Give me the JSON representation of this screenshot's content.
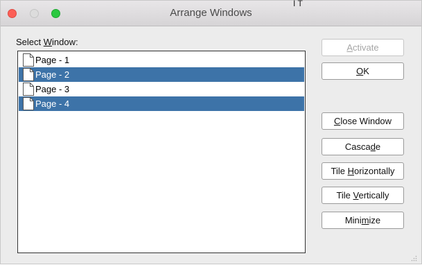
{
  "window": {
    "title": "Arrange Windows",
    "title_fragment": "I T"
  },
  "select_label": {
    "pre": "Select ",
    "mnemonic": "W",
    "post": "indow:"
  },
  "list_items": [
    {
      "label": "Page - 1",
      "selected": false
    },
    {
      "label": "Page - 2",
      "selected": true
    },
    {
      "label": "Page - 3",
      "selected": false
    },
    {
      "label": "Page - 4",
      "selected": true
    }
  ],
  "buttons": {
    "activate": {
      "pre": "",
      "mnemonic": "A",
      "post": "ctivate",
      "enabled": false
    },
    "ok": {
      "pre": "",
      "mnemonic": "O",
      "post": "K",
      "enabled": true
    },
    "close_window": {
      "pre": "",
      "mnemonic": "C",
      "post": "lose Window",
      "enabled": true
    },
    "cascade": {
      "pre": "Casca",
      "mnemonic": "d",
      "post": "e",
      "enabled": true
    },
    "tile_horizontally": {
      "pre": "Tile ",
      "mnemonic": "H",
      "post": "orizontally",
      "enabled": true
    },
    "tile_vertically": {
      "pre": "Tile ",
      "mnemonic": "V",
      "post": "ertically",
      "enabled": true
    },
    "minimize": {
      "pre": "Mini",
      "mnemonic": "m",
      "post": "ize",
      "enabled": true
    }
  },
  "colors": {
    "selection": "#3d73a8",
    "close": "#fc5f57",
    "maximize": "#2ac840"
  }
}
